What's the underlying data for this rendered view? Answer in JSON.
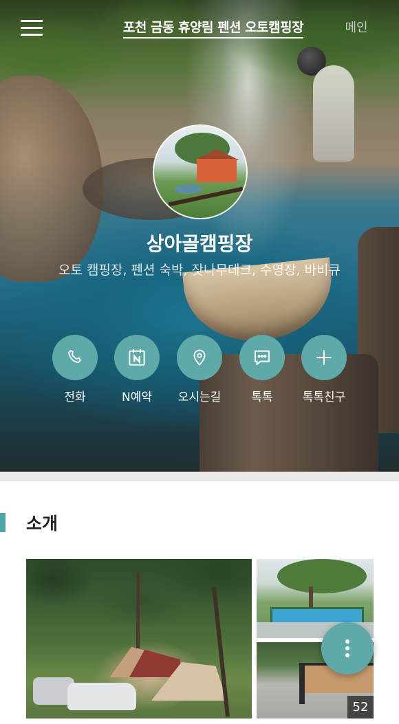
{
  "header": {
    "menu_icon": "hamburger-menu-icon",
    "site_title": "포천 금동 휴양림 펜션 오토캠핑장",
    "main_link": "메인"
  },
  "profile": {
    "name": "상아골캠핑장",
    "description": "오토 캠핑장, 펜션 숙박, 잣나무데크, 수영장, 바비큐"
  },
  "actions": [
    {
      "label": "전화",
      "icon": "phone-icon"
    },
    {
      "label": "N예약",
      "icon": "naver-booking-calendar-icon"
    },
    {
      "label": "오시는길",
      "icon": "location-pin-icon"
    },
    {
      "label": "톡톡",
      "icon": "chat-bubble-icon"
    },
    {
      "label": "톡톡친구",
      "icon": "plus-icon"
    }
  ],
  "intro": {
    "title": "소개",
    "photo_count": "52"
  },
  "fab": {
    "icon": "more-vertical-icon"
  },
  "colors": {
    "accent": "#5fa9a8",
    "section_bar": "#4fa6a6",
    "divider": "#e9e9ec"
  }
}
